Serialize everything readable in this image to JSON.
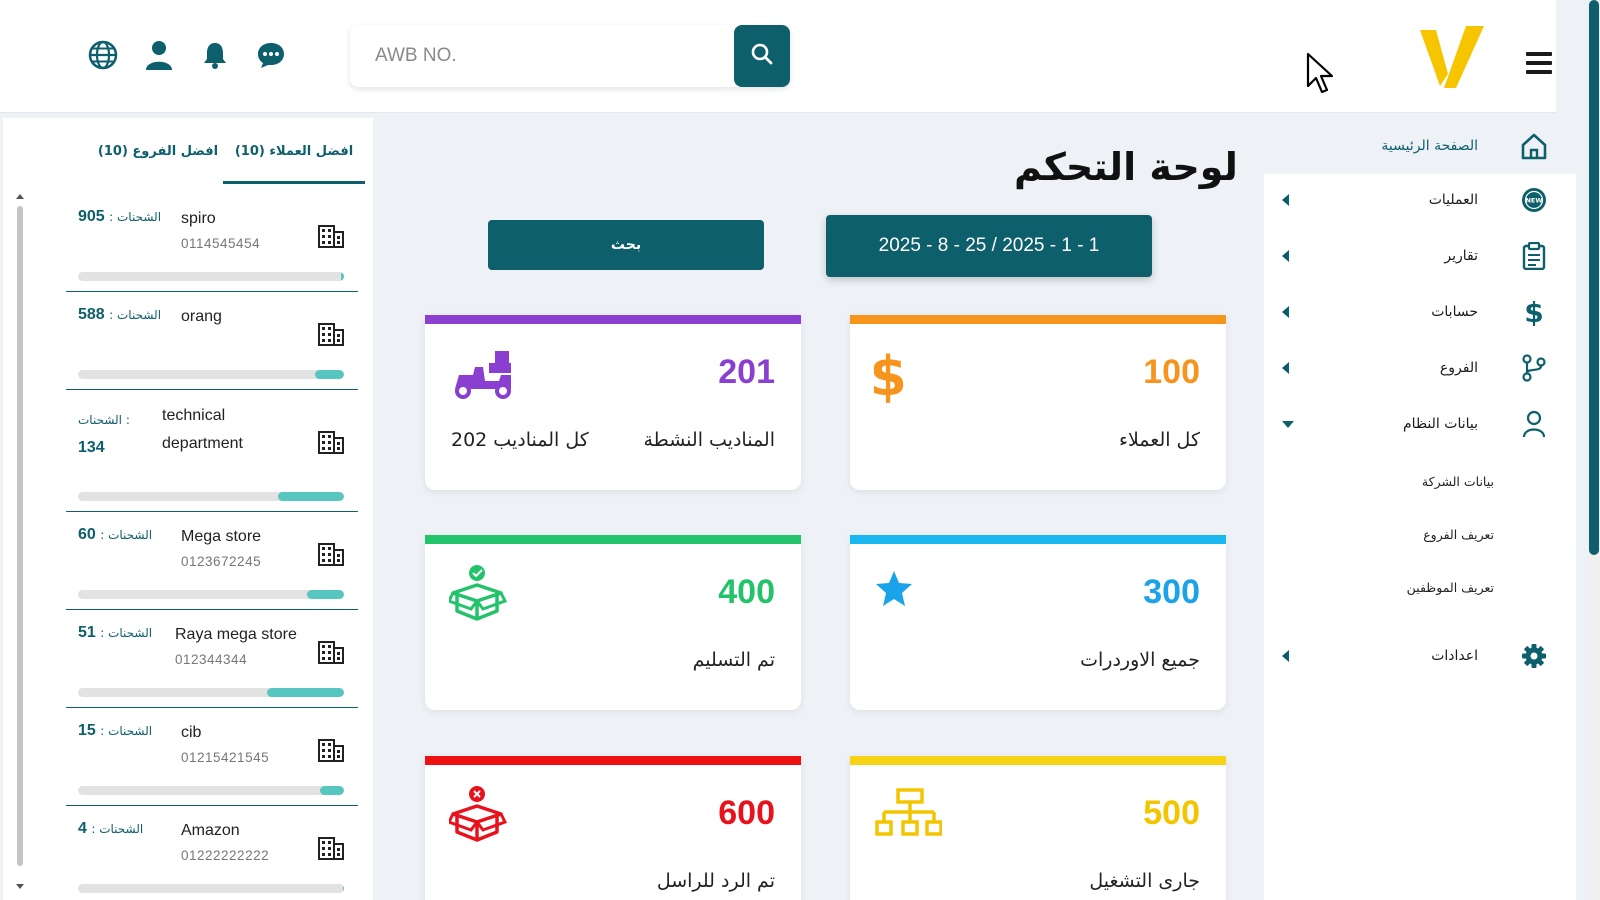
{
  "header": {
    "search_placeholder": "AWB NO.",
    "icons": [
      "globe-icon",
      "user-icon",
      "bell-icon",
      "chat-icon",
      "search-icon"
    ],
    "accent_color": "#0d5f6c",
    "logo_color": "#f7c400"
  },
  "sidebar": {
    "items": [
      {
        "label": "الصفحة الرئيسية",
        "icon": "home-icon",
        "active": true
      },
      {
        "label": "العمليات",
        "icon": "new-badge-icon"
      },
      {
        "label": "تقارير",
        "icon": "clipboard-icon"
      },
      {
        "label": "حسابات",
        "icon": "dollar-icon"
      },
      {
        "label": "الفروع",
        "icon": "branch-icon"
      },
      {
        "label": "بيانات النظام",
        "icon": "person-icon",
        "expanded": true
      },
      {
        "label": "اعدادات",
        "icon": "gear-icon"
      }
    ],
    "sub_items": [
      "بيانات الشركة",
      "تعريف الفروع",
      "تعريف الموظفين"
    ]
  },
  "left_panel": {
    "tabs": [
      "افضل العملاء (10)",
      "افضل الفروع (10)"
    ],
    "count_label": "الشحنات :",
    "clients": [
      {
        "count": "905",
        "name": "spiro",
        "phone": "0114545454",
        "progress": 0.01
      },
      {
        "count": "588",
        "name": "orang",
        "phone": "",
        "progress": 0.11
      },
      {
        "count": "134",
        "name": "technical",
        "name2": "department",
        "phone": "",
        "progress": 0.25
      },
      {
        "count": "60",
        "name": "Mega store",
        "phone": "0123672245",
        "progress": 0.14
      },
      {
        "count": "51",
        "name": "Raya mega store",
        "phone": "012344344",
        "progress": 0.29
      },
      {
        "count": "15",
        "name": "cib",
        "phone": "01215421545",
        "progress": 0.09
      },
      {
        "count": "4",
        "name": "Amazon",
        "phone": "01222222222",
        "progress": 0
      }
    ]
  },
  "main": {
    "title": "لوحة التحكم",
    "date_range": "2025 - 8 - 25 / 2025 - 1 - 1",
    "search_button": "بحث",
    "cards": [
      {
        "value": "100",
        "label": "كل العملاء",
        "color": "#f7941d",
        "line": "#f7941d",
        "icon": "dollar-sign-icon"
      },
      {
        "value": "201",
        "label": "المناديب النشطة",
        "label2": "كل المناديب 202",
        "color": "#8a3fd1",
        "line": "#8a3fd1",
        "icon": "delivery-scooter-icon"
      },
      {
        "value": "300",
        "label": "جميع الاوردرات",
        "color": "#1aa3e8",
        "line": "#1ab6f0",
        "icon": "star-icon"
      },
      {
        "value": "400",
        "label": "تم التسليم",
        "color": "#22c36a",
        "line": "#22c36a",
        "icon": "box-check-icon"
      },
      {
        "value": "500",
        "label": "جارى التشغيل",
        "color": "#f2c500",
        "line": "#f6d314",
        "icon": "hierarchy-icon"
      },
      {
        "value": "600",
        "label": "تم الرد للراسل",
        "color": "#e8121c",
        "line": "#ee1111",
        "icon": "box-cancel-icon"
      }
    ]
  }
}
